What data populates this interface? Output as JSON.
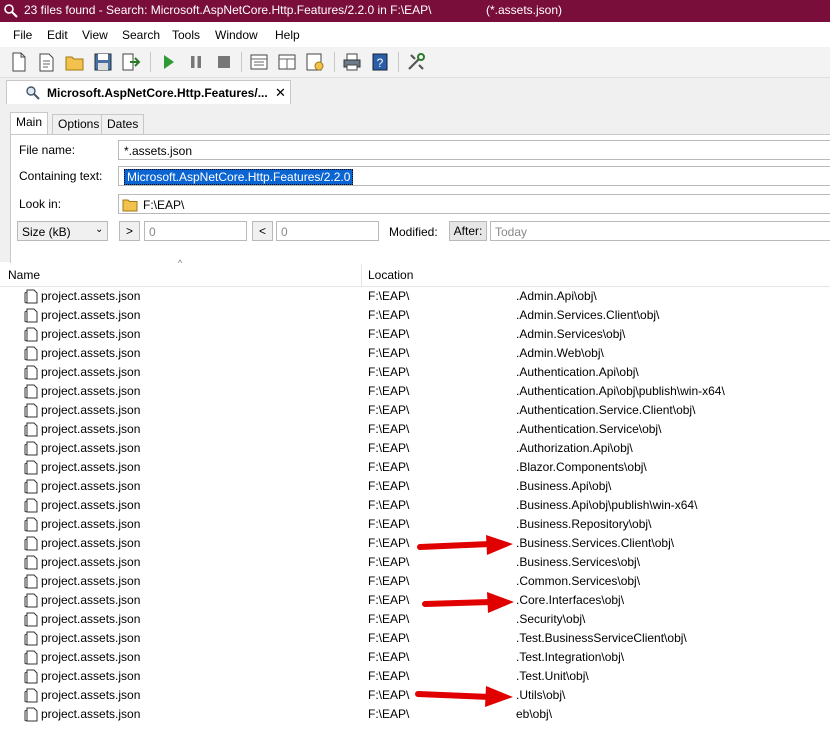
{
  "window": {
    "title_prefix": "23 files found - Search: Microsoft.AspNetCore.Http.Features/2.2.0 in F:\\EAP\\",
    "title_suffix": "(*.assets.json)"
  },
  "menu": [
    "File",
    "Edit",
    "View",
    "Search",
    "Tools",
    "Window",
    "Help"
  ],
  "toolbar_icons": [
    "new-icon",
    "open-icon",
    "open-folder-icon",
    "save-icon",
    "export-icon",
    "play-icon",
    "pause-icon",
    "stop-icon",
    "view-icon",
    "layout-icon",
    "options-icon",
    "print-icon",
    "help-icon",
    "tools-icon"
  ],
  "document_tab": {
    "label": "Microsoft.AspNetCore.Http.Features/...",
    "close": "✕"
  },
  "subtabs": [
    "Main",
    "Options",
    "Dates"
  ],
  "form": {
    "file_name_label": "File name:",
    "file_name_value": "*.assets.json",
    "containing_label": "Containing text:",
    "containing_value": "Microsoft.AspNetCore.Http.Features/2.2.0",
    "look_in_label": "Look in:",
    "look_in_value": "F:\\EAP\\",
    "size_unit": "Size (kB)",
    "gt_button": ">",
    "gt_value": "0",
    "lt_button": "<",
    "lt_value": "0",
    "modified_label": "Modified:",
    "after_button": "After:",
    "date_placeholder": "Today"
  },
  "columns": {
    "name": "Name",
    "location": "Location"
  },
  "rows": [
    {
      "name": "project.assets.json",
      "loc_prefix": "F:\\EAP\\",
      "loc_suffix": ".Admin.Api\\obj\\"
    },
    {
      "name": "project.assets.json",
      "loc_prefix": "F:\\EAP\\",
      "loc_suffix": ".Admin.Services.Client\\obj\\"
    },
    {
      "name": "project.assets.json",
      "loc_prefix": "F:\\EAP\\",
      "loc_suffix": ".Admin.Services\\obj\\"
    },
    {
      "name": "project.assets.json",
      "loc_prefix": "F:\\EAP\\",
      "loc_suffix": ".Admin.Web\\obj\\"
    },
    {
      "name": "project.assets.json",
      "loc_prefix": "F:\\EAP\\",
      "loc_suffix": ".Authentication.Api\\obj\\"
    },
    {
      "name": "project.assets.json",
      "loc_prefix": "F:\\EAP\\",
      "loc_suffix": ".Authentication.Api\\obj\\publish\\win-x64\\"
    },
    {
      "name": "project.assets.json",
      "loc_prefix": "F:\\EAP\\",
      "loc_suffix": ".Authentication.Service.Client\\obj\\"
    },
    {
      "name": "project.assets.json",
      "loc_prefix": "F:\\EAP\\",
      "loc_suffix": ".Authentication.Service\\obj\\"
    },
    {
      "name": "project.assets.json",
      "loc_prefix": "F:\\EAP\\",
      "loc_suffix": ".Authorization.Api\\obj\\"
    },
    {
      "name": "project.assets.json",
      "loc_prefix": "F:\\EAP\\",
      "loc_suffix": ".Blazor.Components\\obj\\"
    },
    {
      "name": "project.assets.json",
      "loc_prefix": "F:\\EAP\\",
      "loc_suffix": ".Business.Api\\obj\\"
    },
    {
      "name": "project.assets.json",
      "loc_prefix": "F:\\EAP\\",
      "loc_suffix": ".Business.Api\\obj\\publish\\win-x64\\"
    },
    {
      "name": "project.assets.json",
      "loc_prefix": "F:\\EAP\\",
      "loc_suffix": ".Business.Repository\\obj\\"
    },
    {
      "name": "project.assets.json",
      "loc_prefix": "F:\\EAP\\",
      "loc_suffix": ".Business.Services.Client\\obj\\"
    },
    {
      "name": "project.assets.json",
      "loc_prefix": "F:\\EAP\\",
      "loc_suffix": ".Business.Services\\obj\\"
    },
    {
      "name": "project.assets.json",
      "loc_prefix": "F:\\EAP\\",
      "loc_suffix": ".Common.Services\\obj\\"
    },
    {
      "name": "project.assets.json",
      "loc_prefix": "F:\\EAP\\",
      "loc_suffix": ".Core.Interfaces\\obj\\"
    },
    {
      "name": "project.assets.json",
      "loc_prefix": "F:\\EAP\\",
      "loc_suffix": ".Security\\obj\\"
    },
    {
      "name": "project.assets.json",
      "loc_prefix": "F:\\EAP\\",
      "loc_suffix": ".Test.BusinessServiceClient\\obj\\"
    },
    {
      "name": "project.assets.json",
      "loc_prefix": "F:\\EAP\\",
      "loc_suffix": ".Test.Integration\\obj\\"
    },
    {
      "name": "project.assets.json",
      "loc_prefix": "F:\\EAP\\",
      "loc_suffix": ".Test.Unit\\obj\\"
    },
    {
      "name": "project.assets.json",
      "loc_prefix": "F:\\EAP\\",
      "loc_suffix": ".Utils\\obj\\"
    },
    {
      "name": "project.assets.json",
      "loc_prefix": "F:\\EAP\\",
      "loc_suffix": "eb\\obj\\"
    }
  ],
  "colors": {
    "titlebar": "#7a0e3b",
    "selection": "#0a64d2",
    "arrow": "#e00000"
  }
}
